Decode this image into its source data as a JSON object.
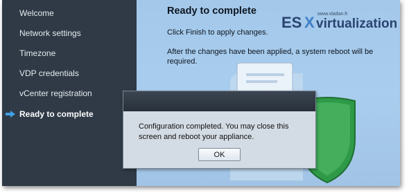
{
  "sidebar": {
    "items": [
      {
        "label": "Welcome"
      },
      {
        "label": "Network settings"
      },
      {
        "label": "Timezone"
      },
      {
        "label": "VDP credentials"
      },
      {
        "label": "vCenter registration"
      },
      {
        "label": "Ready to complete",
        "active": true
      }
    ]
  },
  "main": {
    "title": "Ready to complete",
    "line1": "Click Finish to apply changes.",
    "line2": "After the changes have been applied, a system reboot will be required."
  },
  "dialog": {
    "message": "Configuration completed. You may close this screen and reboot your appliance.",
    "ok_label": "OK"
  },
  "watermark": {
    "prefix": "ES",
    "x": "X",
    "suffix": "virtualization",
    "url": "www.vladan.fr"
  },
  "colors": {
    "sidebar": "#2f3a46",
    "main": "#a6cbec",
    "accent_arrow": "#3fa0e6",
    "shield": "#2e9a48",
    "dialog": "#d3dbe4"
  },
  "icons": {
    "active_marker": "arrow-right-icon",
    "illustration": "shield-icon"
  }
}
